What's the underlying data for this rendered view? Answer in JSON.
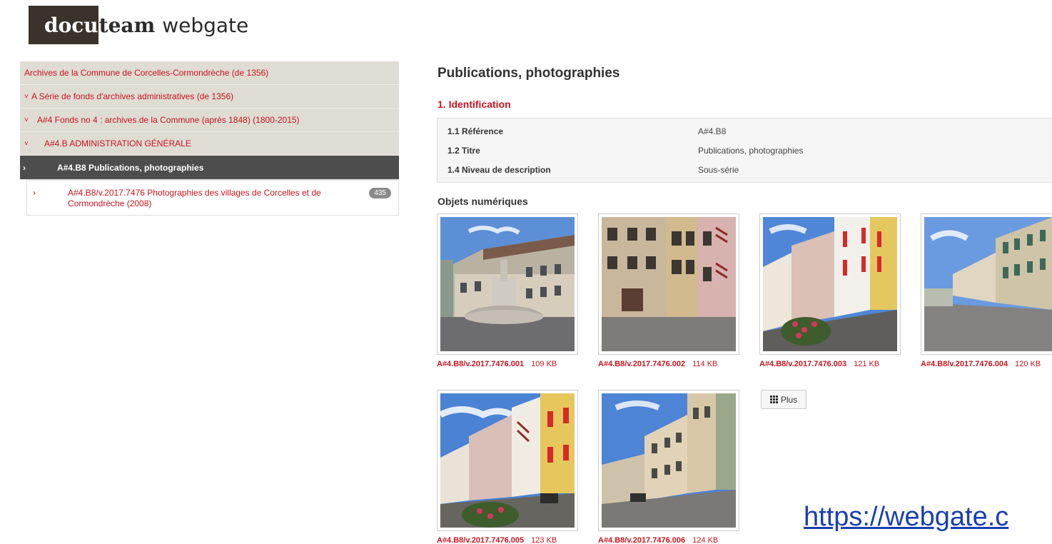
{
  "logo": {
    "part1": "docu",
    "part2": "team",
    "part3": "webgate"
  },
  "tree": {
    "items": [
      {
        "label": "Archives de la Commune de Corcelles-Cormondrèche (de 1356)",
        "chev": ""
      },
      {
        "label": "A Série de fonds d'archives administratives (de 1356)",
        "chev": "˅"
      },
      {
        "label": "A#4 Fonds no 4 : archives de la Commune (après 1848) (1800-2015)",
        "chev": "˅"
      },
      {
        "label": "A#4.B ADMINISTRATION GÉNÉRALE",
        "chev": "˅"
      },
      {
        "label": "A#4.B8 Publications, photographies",
        "chev": "›"
      }
    ],
    "child": {
      "chev": "›",
      "label": "A#4.B8/v.2017.7476 Photographies des villages de Corcelles et de Cormondrèche (2008)",
      "badge": "435"
    }
  },
  "main": {
    "title": "Publications, photographies",
    "section_identification": "1. Identification",
    "identification": [
      {
        "label": "1.1 Référence",
        "value": "A#4.B8"
      },
      {
        "label": "1.2 Titre",
        "value": "Publications, photographies"
      },
      {
        "label": "1.4 Niveau de description",
        "value": "Sous-série"
      }
    ],
    "objects_title": "Objets numériques",
    "objects": [
      {
        "id": "A#4.B8/v.2017.7476.001",
        "size": "109 KB"
      },
      {
        "id": "A#4.B8/v.2017.7476.002",
        "size": "114 KB"
      },
      {
        "id": "A#4.B8/v.2017.7476.003",
        "size": "121 KB"
      },
      {
        "id": "A#4.B8/v.2017.7476.004",
        "size": "120 KB"
      },
      {
        "id": "A#4.B8/v.2017.7476.005",
        "size": "123 KB"
      },
      {
        "id": "A#4.B8/v.2017.7476.006",
        "size": "124 KB"
      }
    ],
    "more_label": "Plus"
  },
  "overlay_url": "https://webgate.c",
  "colors": {
    "accent": "#c8141e",
    "tree_bg": "#dedcd3",
    "tree_current": "#4d4d4d",
    "logo_box": "#3a332c"
  }
}
